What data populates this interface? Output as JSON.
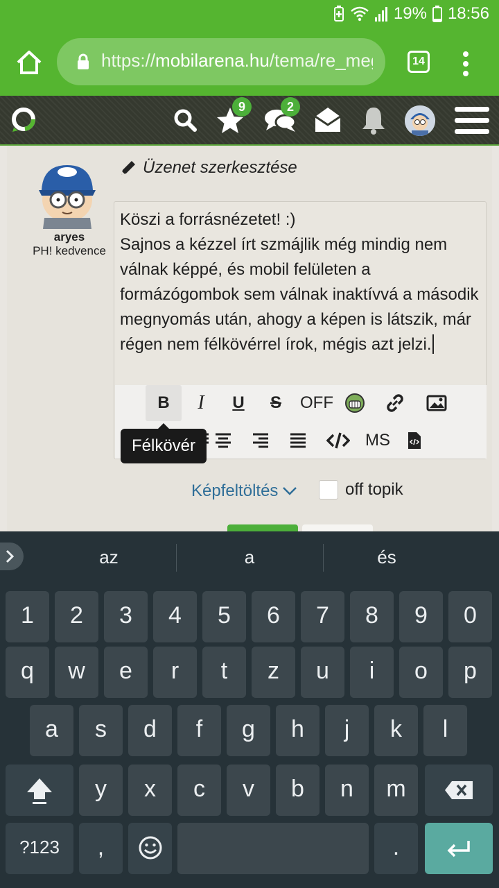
{
  "status_bar": {
    "battery": "19%",
    "time": "18:56"
  },
  "browser": {
    "url_scheme": "https://",
    "url_host": "mobilarena.hu",
    "url_path": "/tema/re_meg",
    "tab_count": "14"
  },
  "site_nav": {
    "favorites_badge": "9",
    "messages_badge": "2"
  },
  "post": {
    "username": "aryes",
    "user_rank": "PH! kedvence",
    "edit_title": "Üzenet szerkesztése",
    "body": "Köszi a forrásnézetet! :)\nSajnos a kézzel írt szmájlik még mindig nem válnak képpé, és mobil felületen a formázógombok sem válnak inaktívvá a második megnyomás után, ahogy a képen is látszik, már régen nem félkövérrel írok, mégis azt jelzi."
  },
  "toolbar": {
    "bold": "B",
    "italic": "I",
    "underline": "U",
    "strike": "S",
    "off": "OFF",
    "ms": "MS",
    "tooltip": "Félkövér"
  },
  "upload": {
    "label": "Képfeltöltés"
  },
  "offtopic": {
    "label": "off topik"
  },
  "keyboard": {
    "suggestions": [
      "az",
      "a",
      "és"
    ],
    "row_numbers": [
      "1",
      "2",
      "3",
      "4",
      "5",
      "6",
      "7",
      "8",
      "9",
      "0"
    ],
    "row1": [
      "q",
      "w",
      "e",
      "r",
      "t",
      "z",
      "u",
      "i",
      "o",
      "p"
    ],
    "row2": [
      "a",
      "s",
      "d",
      "f",
      "g",
      "h",
      "j",
      "k",
      "l"
    ],
    "row3": [
      "y",
      "x",
      "c",
      "v",
      "b",
      "n",
      "m"
    ],
    "symbols_key": "?123",
    "comma_key": ",",
    "period_key": "."
  }
}
